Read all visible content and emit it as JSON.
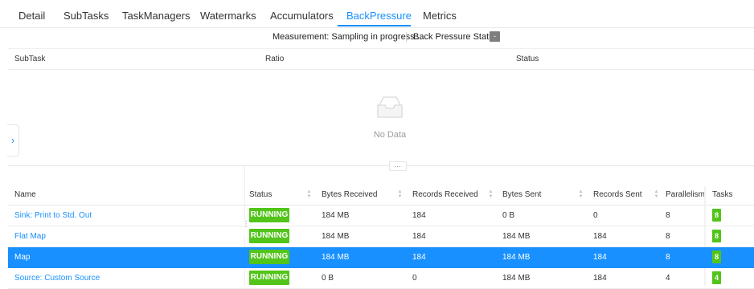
{
  "tabs": [
    {
      "label": "Detail"
    },
    {
      "label": "SubTasks"
    },
    {
      "label": "TaskManagers"
    },
    {
      "label": "Watermarks"
    },
    {
      "label": "Accumulators"
    },
    {
      "label": "BackPressure",
      "active": true
    },
    {
      "label": "Metrics"
    }
  ],
  "backpressure": {
    "measurement": "Measurement: Sampling in progress...",
    "status_label": "Back Pressure Status:",
    "status_value": "-",
    "columns": [
      "SubTask",
      "Ratio",
      "Status"
    ],
    "empty_text": "No Data"
  },
  "vertex_table": {
    "columns": [
      "Name",
      "Status",
      "Bytes Received",
      "Records Received",
      "Bytes Sent",
      "Records Sent",
      "Parallelism",
      "Tasks"
    ],
    "rows": [
      {
        "name": "Sink: Print to Std. Out",
        "status": "RUNNING",
        "bytes_received": "184 MB",
        "records_received": "184",
        "bytes_sent": "0 B",
        "records_sent": "0",
        "parallelism": "8",
        "tasks": "8"
      },
      {
        "name": "Flat Map",
        "status": "RUNNING",
        "bytes_received": "184 MB",
        "records_received": "184",
        "bytes_sent": "184 MB",
        "records_sent": "184",
        "parallelism": "8",
        "tasks": "8"
      },
      {
        "name": "Map",
        "status": "RUNNING",
        "bytes_received": "184 MB",
        "records_received": "184",
        "bytes_sent": "184 MB",
        "records_sent": "184",
        "parallelism": "8",
        "tasks": "8",
        "selected": true
      },
      {
        "name": "Source: Custom Source",
        "status": "RUNNING",
        "bytes_received": "0 B",
        "records_received": "0",
        "bytes_sent": "184 MB",
        "records_sent": "184",
        "parallelism": "4",
        "tasks": "4"
      }
    ]
  },
  "colors": {
    "accent": "#1890ff",
    "running": "#52c41a",
    "selected_row": "#1890ff"
  }
}
